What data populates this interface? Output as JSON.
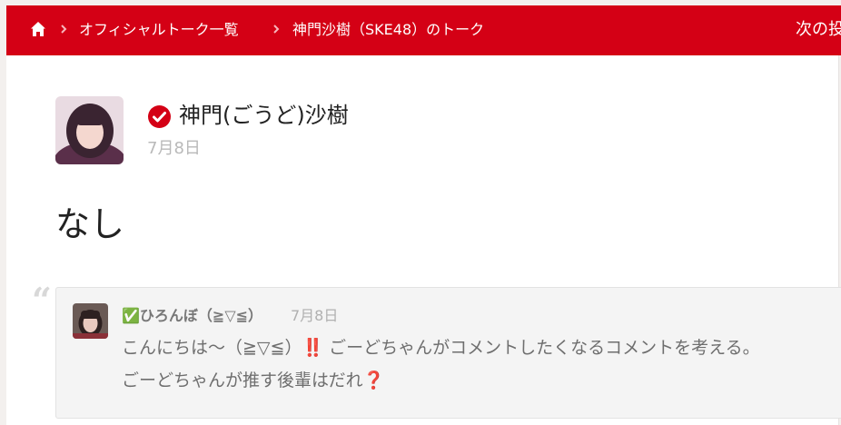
{
  "breadcrumb": {
    "home_icon": "home-icon",
    "items": [
      {
        "label": "オフィシャルトーク一覧"
      },
      {
        "label": "神門沙樹（SKE48）のトーク"
      }
    ],
    "next_label": "次の投"
  },
  "post": {
    "author": "神門(ごうど)沙樹",
    "verified_icon": "check-badge-icon",
    "date": "7月8日",
    "body": "なし"
  },
  "comment": {
    "quote_icon": "quote-icon",
    "author": "✅ひろんぼ（≧▽≦）",
    "date": "7月8日",
    "lines": [
      "こんにちは～（≧▽≦）‼️ ごーどちゃんがコメントしたくなるコメントを考える。",
      "ごーどちゃんが推す後輩はだれ❓"
    ]
  },
  "colors": {
    "header_bg": "#d40015",
    "verified": "#d40015"
  }
}
